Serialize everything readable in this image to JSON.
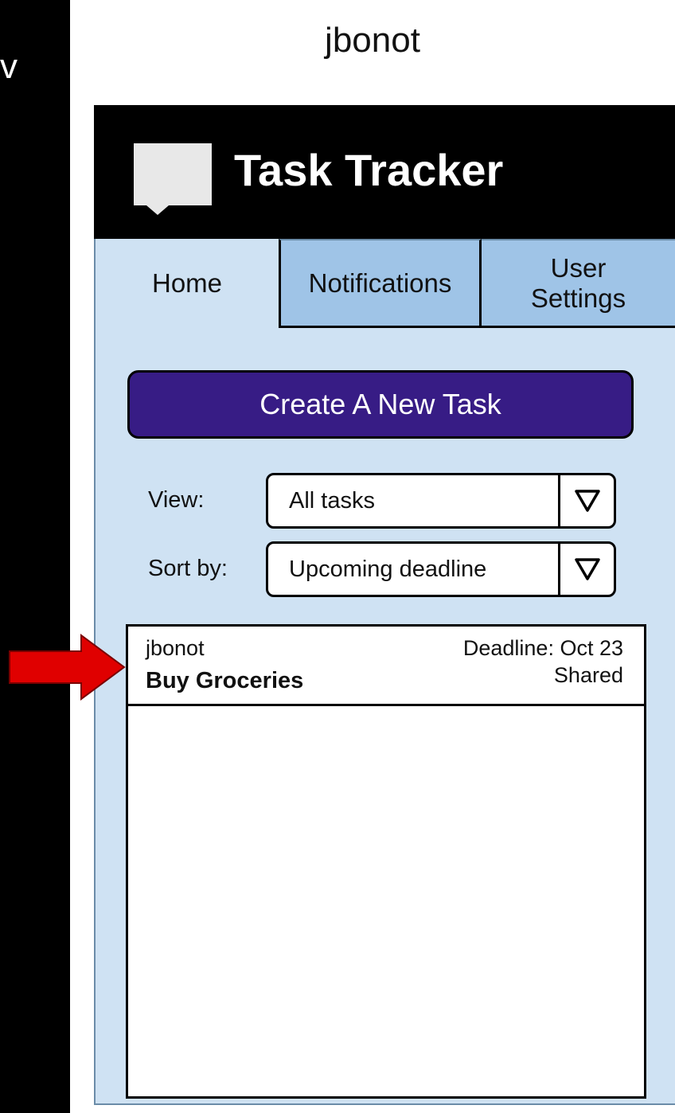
{
  "left_stub_text": "v",
  "user": {
    "username": "jbonot"
  },
  "header": {
    "app_title": "Task Tracker",
    "logo_icon": "speech-bubble-icon"
  },
  "tabs": [
    {
      "label": "Home",
      "active": true
    },
    {
      "label": "Notifications",
      "active": false
    },
    {
      "label": "User\nSettings",
      "active": false
    }
  ],
  "actions": {
    "create_label": "Create A New Task"
  },
  "filters": {
    "view_label": "View:",
    "view_value": "All tasks",
    "sort_label": "Sort by:",
    "sort_value": "Upcoming deadline"
  },
  "tasks": [
    {
      "owner": "jbonot",
      "title": "Buy Groceries",
      "deadline": "Deadline: Oct 23",
      "status": "Shared"
    }
  ],
  "annotation": {
    "arrow_icon": "red-arrow-icon",
    "arrow_color": "#e00000"
  },
  "colors": {
    "background": "#000000",
    "panel": "#cfe2f3",
    "inactive_tab": "#9fc4e7",
    "primary_button": "#371c85"
  }
}
